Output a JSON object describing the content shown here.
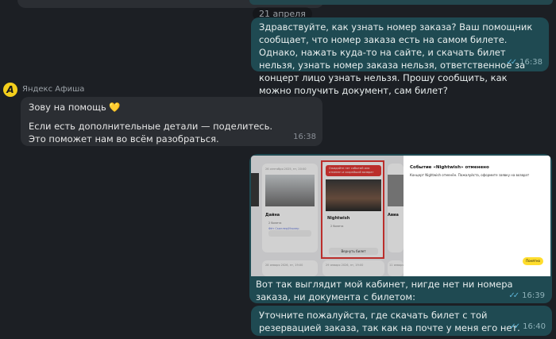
{
  "date_divider": "21 апреля",
  "messages": [
    {
      "text": "Здравствуйте, как узнать номер заказа? Ваш помощник сообщает, что номер заказа есть на самом билете. Однако, нажать куда-то на сайте, и скачать билет нельзя, узнать номер заказа нельзя, ответственное за концерт лицо узнать нельзя. Прошу сообщить, как можно получить документ, сам билет?",
      "time": "16:38"
    },
    {
      "sender": "Яндекс Афиша",
      "avatar_letter": "A",
      "line1": "Зову на помощь 💛",
      "line2": "Если есть дополнительные детали — поделитесь. Это поможет нам во всём разобраться.",
      "time": "16:38"
    },
    {
      "caption": "Вот так выглядит мой кабинет, нигде нет ни номера заказа, ни документа с билетом:",
      "time": "16:39"
    },
    {
      "text": "Уточните пожалуйста, где скачать билет с той резервацией заказа, так как на почте у меня его нет.",
      "time": "16:40"
    }
  ],
  "screenshot": {
    "card1": {
      "date": "26 сентября 2025, пт, 20:00",
      "name": "Дайна",
      "tickets": "2 билета",
      "tag": "Фёт Скиллер/Изолер"
    },
    "card2": {
      "warning": "Ожидайте нет событий или отменен и скорейший возврат",
      "name": "Nightwish",
      "tickets": "2 билета",
      "button": "Вернуть билет"
    },
    "card3": {
      "name": "Авиа"
    },
    "bottom_dates": [
      "28 января 2026, пт, 19:00",
      "29 января 2026, пт, 19:00",
      "11 января 2026, пт, 20:00"
    ],
    "panel": {
      "title": "Событие «Nightwish» отменено",
      "body": "Концерт Nightwish отменён. Пожалуйста, оформите заявку на возврат",
      "button": "Понятно"
    }
  }
}
